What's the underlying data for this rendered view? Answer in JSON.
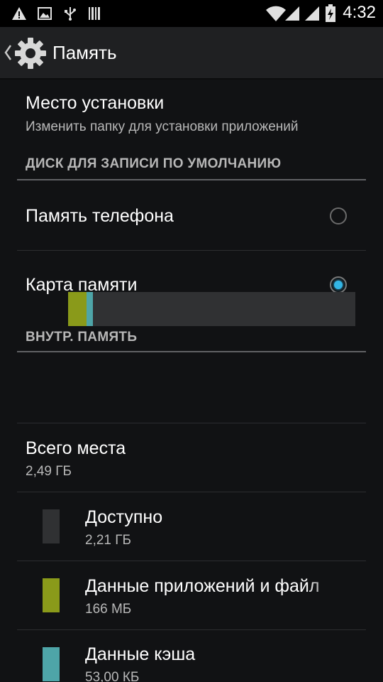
{
  "status_bar": {
    "time": "4:32",
    "left_icons": [
      "warning-icon",
      "image-icon",
      "usb-icon",
      "barcode-icon"
    ],
    "right_icons": [
      "wifi-icon",
      "signal-icon",
      "battery-charging-icon",
      "signal-icon"
    ]
  },
  "action_bar": {
    "title": "Память",
    "icon": "gear-icon"
  },
  "install_location": {
    "title": "Место установки",
    "summary": "Изменить папку для установки приложений"
  },
  "default_disk": {
    "header": "ДИСК ДЛЯ ЗАПИСИ ПО УМОЛЧАНИЮ",
    "options": [
      {
        "label": "Память телефона",
        "checked": false
      },
      {
        "label": "Карта памяти",
        "checked": true
      }
    ]
  },
  "internal": {
    "header": "ВНУТР. ПАМЯТЬ",
    "usage_bar": [
      {
        "fraction": 0.065,
        "color": "#8a9a1a"
      },
      {
        "fraction": 0.021,
        "color": "#4ea5a8"
      }
    ],
    "total": {
      "title": "Всего места",
      "value": "2,49 ГБ"
    },
    "items": [
      {
        "title": "Доступно",
        "value": "2,21 ГБ",
        "color": "#303133"
      },
      {
        "title": "Данные приложений и файл",
        "value": "166 МБ",
        "color": "#8a9a1a"
      },
      {
        "title": "Данные кэша",
        "value": "53,00 КБ",
        "color": "#4ea5a8"
      }
    ]
  },
  "colors": {
    "accent": "#33b5e5",
    "apps": "#8a9a1a",
    "cache": "#4ea5a8",
    "free": "#303133"
  }
}
